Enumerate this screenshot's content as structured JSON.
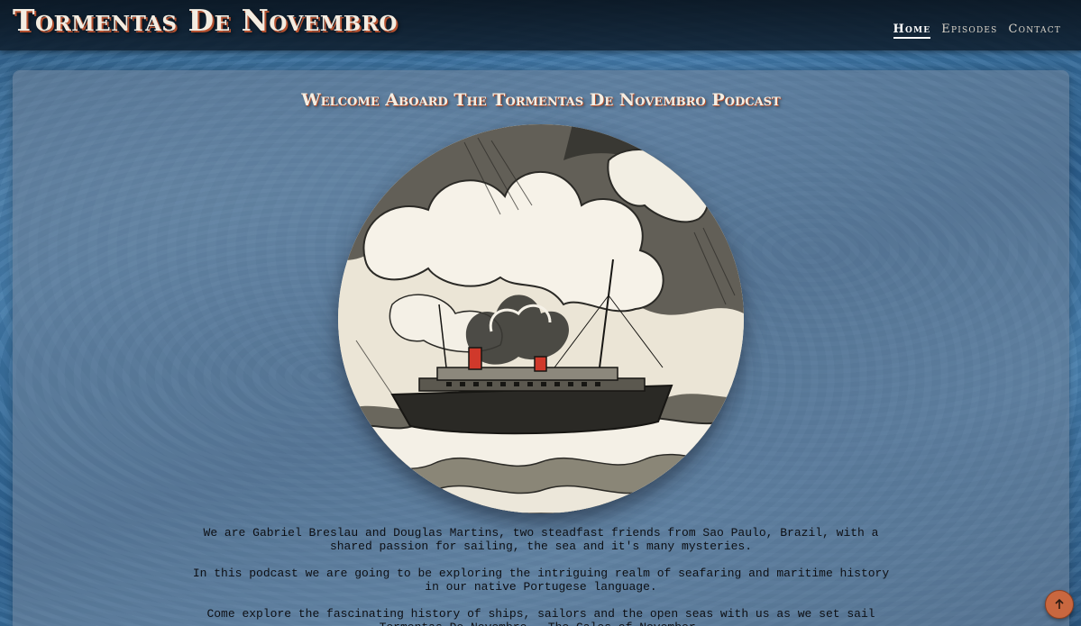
{
  "header": {
    "site_title": "Tormentas De Novembro",
    "nav": [
      {
        "label": "Home",
        "active": true
      },
      {
        "label": "Episodes",
        "active": false
      },
      {
        "label": "Contact",
        "active": false
      }
    ]
  },
  "main": {
    "heading": "Welcome Aboard The Tormentas De Novembro Podcast",
    "image": {
      "icon": "steamship-illustration"
    },
    "paragraphs": [
      "We are Gabriel Breslau and Douglas Martins, two steadfast friends from Sao Paulo, Brazil, with a shared passion for sailing, the sea and it's many mysteries.",
      "In this podcast we are going to be exploring the intriguing realm of seafaring and maritime history in our native Portugese language.",
      "Come explore the fascinating history of ships, sailors and the open seas with us as we set sail Tormentas De Novembro - The Gales of November."
    ]
  },
  "back_to_top": {
    "icon": "arrow-up-icon"
  },
  "colors": {
    "accent": "#b4502f",
    "button": "#c9673f",
    "header_bg": "#0e1e2e",
    "card_bg": "#6e829b"
  }
}
